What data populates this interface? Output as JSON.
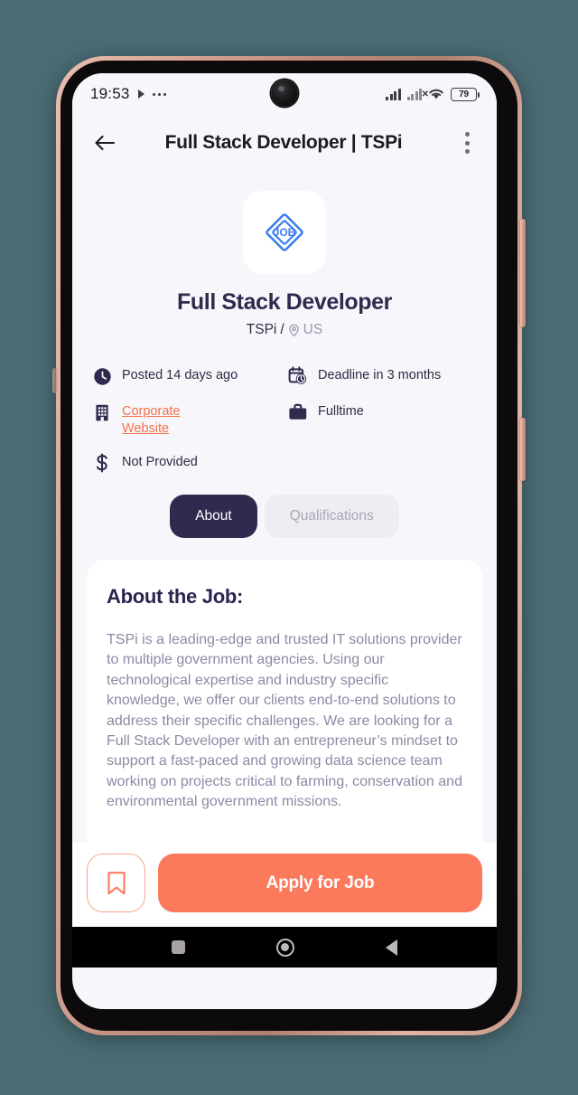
{
  "status_bar": {
    "time": "19:53",
    "play_icon": "play-icon",
    "more_icon": "more-horizontal-icon",
    "signal_icon": "cellular-signal-icon",
    "signal_alt_icon": "cellular-signal-no-service-icon",
    "wifi_icon": "wifi-icon",
    "battery_level": "79"
  },
  "app_bar": {
    "back_icon": "back-arrow-icon",
    "title": "Full Stack Developer | TSPi",
    "menu_icon": "kebab-menu-icon"
  },
  "job": {
    "logo_text": "JOB",
    "title": "Full Stack Developer",
    "company": "TSPi",
    "separator": "/",
    "location_icon": "location-pin-icon",
    "location": "US"
  },
  "info": [
    {
      "icon": "clock-icon",
      "text": "Posted 14 days ago",
      "link": false
    },
    {
      "icon": "calendar-clock-icon",
      "text": "Deadline in 3 months",
      "link": false
    },
    {
      "icon": "building-icon",
      "text": "Corporate Website",
      "link": true
    },
    {
      "icon": "briefcase-icon",
      "text": "Fulltime",
      "link": false
    },
    {
      "icon": "dollar-icon",
      "text": "Not Provided",
      "link": false
    }
  ],
  "tabs": [
    {
      "label": "About",
      "active": true
    },
    {
      "label": "Qualifications",
      "active": false
    }
  ],
  "about": {
    "heading": "About the Job:",
    "body": "TSPi is a leading-edge and trusted IT solutions provider to multiple government agencies. Using our technological expertise and industry specific knowledge, we offer our clients end-to-end solutions to address their specific challenges. We are looking for a Full Stack Developer with an entrepreneur’s mindset to support a fast-paced and growing data science team working on projects critical to farming, conservation and environmental government missions."
  },
  "actions": {
    "save_icon": "bookmark-icon",
    "apply_label": "Apply for Job"
  },
  "nav_bar": {
    "recent_icon": "recent-apps-icon",
    "home_icon": "home-icon",
    "back_icon": "back-triangle-icon"
  },
  "colors": {
    "accent_orange": "#fb7a5c",
    "dark_purple": "#312a4e",
    "muted_text": "#8c8aa4",
    "page_bg": "#f7f7fb",
    "desk_bg": "#4a6b73"
  }
}
